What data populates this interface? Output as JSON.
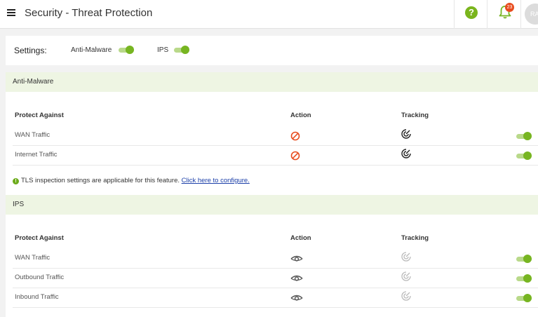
{
  "header": {
    "title": "Security - Threat Protection",
    "menu_icon": "hamburger-menu-icon",
    "help_icon": "help-icon",
    "help_glyph": "?",
    "bell_icon": "bell-icon",
    "notification_count": "23",
    "avatar_initials": "RA"
  },
  "settings": {
    "label": "Settings:",
    "anti_malware_label": "Anti-Malware",
    "anti_malware_on": true,
    "ips_label": "IPS",
    "ips_on": true
  },
  "anti_malware": {
    "title": "Anti-Malware",
    "columns": {
      "protect": "Protect Against",
      "action": "Action",
      "tracking": "Tracking"
    },
    "rows": [
      {
        "label": "WAN Traffic",
        "action_icon": "block-icon",
        "tracking_icon": "radar-icon",
        "tracking_active": true,
        "enabled": true
      },
      {
        "label": "Internet Traffic",
        "action_icon": "block-icon",
        "tracking_icon": "radar-icon",
        "tracking_active": true,
        "enabled": true
      }
    ],
    "notice": {
      "text": "TLS inspection settings are applicable for this feature. ",
      "link": "Click here to configure.",
      "icon": "info-icon",
      "icon_glyph": "!"
    }
  },
  "ips": {
    "title": "IPS",
    "columns": {
      "protect": "Protect Against",
      "action": "Action",
      "tracking": "Tracking"
    },
    "rows": [
      {
        "label": "WAN Traffic",
        "action_icon": "eye-icon",
        "tracking_icon": "radar-icon",
        "tracking_active": false,
        "enabled": true
      },
      {
        "label": "Outbound Traffic",
        "action_icon": "eye-icon",
        "tracking_icon": "radar-icon",
        "tracking_active": false,
        "enabled": true
      },
      {
        "label": "Inbound Traffic",
        "action_icon": "eye-icon",
        "tracking_icon": "radar-icon",
        "tracking_active": false,
        "enabled": true
      }
    ]
  },
  "colors": {
    "accent_green": "#77b521",
    "toggle_track": "#b9d98a",
    "section_bg": "#eef5e3",
    "block_red": "#e84c1e",
    "link_blue": "#1a3ea8"
  }
}
